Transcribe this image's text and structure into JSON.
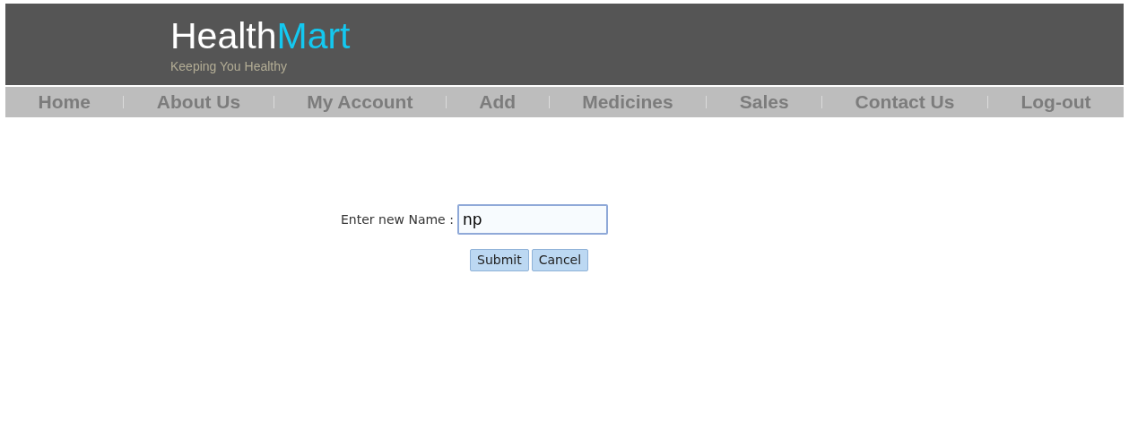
{
  "logo": {
    "part_1": "Health",
    "part_2": "Mart",
    "tagline": "Keeping You Healthy"
  },
  "nav": [
    {
      "label": "Home"
    },
    {
      "label": "About Us"
    },
    {
      "label": "My Account"
    },
    {
      "label": "Add"
    },
    {
      "label": "Medicines"
    },
    {
      "label": "Sales"
    },
    {
      "label": "Contact Us"
    },
    {
      "label": "Log-out"
    }
  ],
  "form": {
    "label": "Enter new Name :",
    "value": "np",
    "buttons": [
      "Submit",
      "Cancel"
    ]
  }
}
